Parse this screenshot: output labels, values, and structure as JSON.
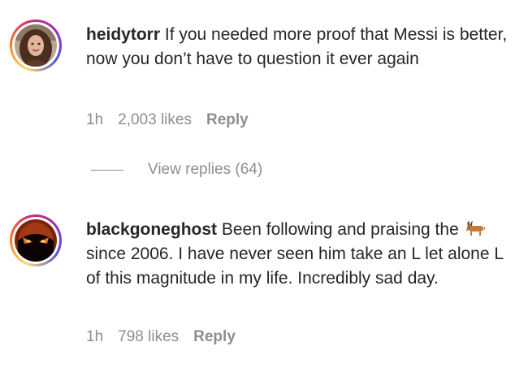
{
  "comments": [
    {
      "username": "heidytorr",
      "text": "If you needed more proof that Messi is better, now you don’t have to question it ever again",
      "time": "1h",
      "likes": "2,003 likes",
      "reply": "Reply"
    },
    {
      "username": "blackgoneghost",
      "text_before": "Been following and praising the",
      "emoji": "goat-icon",
      "text_after": "since 2006. I have never seen him take an L let alone L of this magnitude in my life. Incredibly sad day.",
      "time": "1h",
      "likes": "798 likes",
      "reply": "Reply"
    }
  ],
  "view_replies": {
    "label": "View replies (64)"
  },
  "colors": {
    "text": "#262626",
    "secondary": "#8e8e8e",
    "ring_start": "#feda75",
    "ring_end": "#962fbf"
  }
}
